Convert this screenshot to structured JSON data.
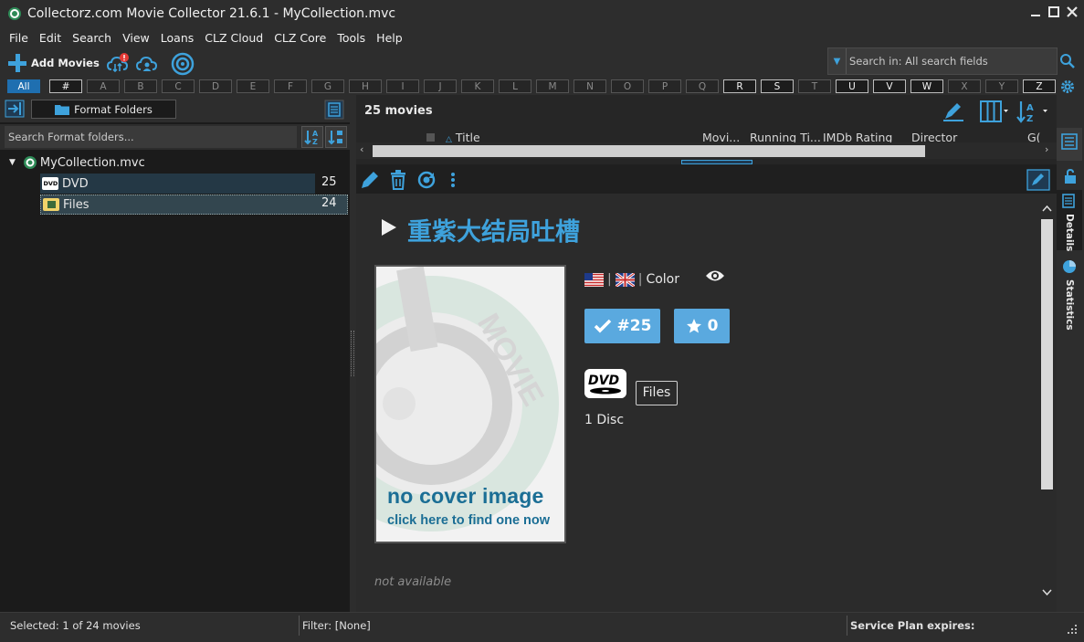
{
  "window": {
    "title": "Collectorz.com Movie Collector 21.6.1 - MyCollection.mvc"
  },
  "menu": [
    "File",
    "Edit",
    "Search",
    "View",
    "Loans",
    "CLZ Cloud",
    "CLZ Core",
    "Tools",
    "Help"
  ],
  "toolbar": {
    "add_movies": "Add Movies",
    "search_placeholder": "Search in: All search fields"
  },
  "alphabet": {
    "items": [
      "All",
      "#",
      "A",
      "B",
      "C",
      "D",
      "E",
      "F",
      "G",
      "H",
      "I",
      "J",
      "K",
      "L",
      "M",
      "N",
      "O",
      "P",
      "Q",
      "R",
      "S",
      "T",
      "U",
      "V",
      "W",
      "X",
      "Y",
      "Z"
    ],
    "active": [
      "All",
      "#",
      "R",
      "S",
      "U",
      "V",
      "W",
      "Z"
    ]
  },
  "left_panel": {
    "folder_button": "Format Folders",
    "search_placeholder": "Search Format folders...",
    "tree": {
      "root": "MyCollection.mvc",
      "children": [
        {
          "label": "DVD",
          "count": "25"
        },
        {
          "label": "Files",
          "count": "24"
        }
      ]
    }
  },
  "list": {
    "count_label": "25 movies",
    "columns": [
      "Title",
      "Movi...",
      "Running Ti...",
      "IMDb Rating",
      "Director",
      "G("
    ]
  },
  "details": {
    "title": "重紫大结局吐槽",
    "color": "Color",
    "collection_number": "#25",
    "rating": "0",
    "format_tag": "Files",
    "discs": "1 Disc",
    "cover_line1": "no cover image",
    "cover_line2": "click here to find one now",
    "trailer_text": "not available"
  },
  "side_tabs": {
    "details": "Details",
    "statistics": "Statistics"
  },
  "status": {
    "selected": "Selected: 1 of 24 movies",
    "filter": "Filter: [None]",
    "service": "Service Plan expires:"
  },
  "colors": {
    "accent": "#3ea2dc",
    "badge": "#5aa9df",
    "background": "#2b2b2b"
  }
}
